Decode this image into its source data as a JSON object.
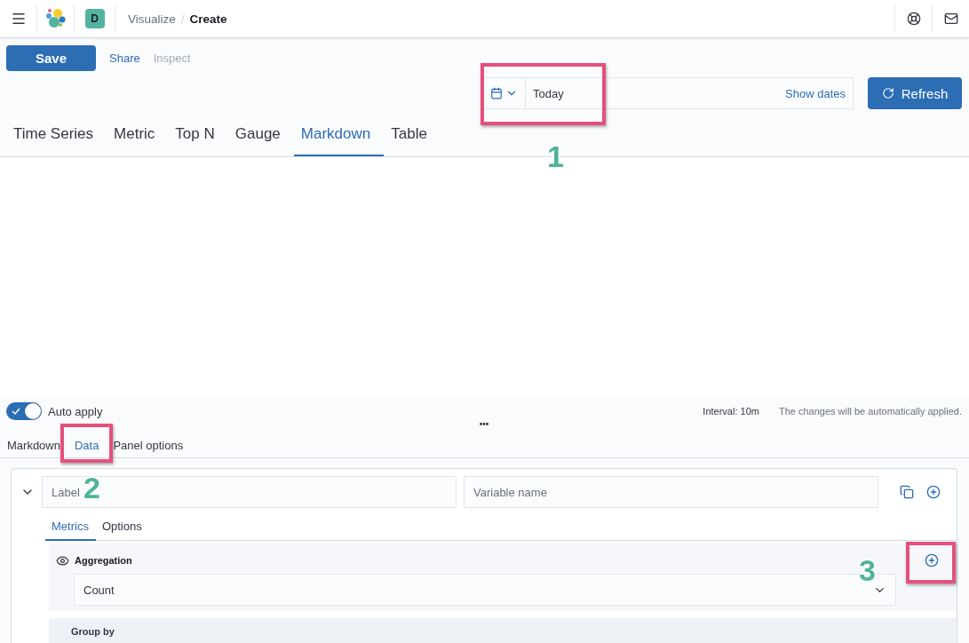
{
  "header": {
    "avatar": "D",
    "separator": "/",
    "breadcrumbs": [
      {
        "label": "Visualize",
        "current": false
      },
      {
        "label": "Create",
        "current": true
      }
    ]
  },
  "actions": [
    {
      "label": "Save",
      "kind": "primary",
      "disabled": false
    },
    {
      "label": "Share",
      "kind": "link",
      "disabled": false
    },
    {
      "label": "Inspect",
      "kind": "link",
      "disabled": true
    }
  ],
  "date_picker": {
    "value": "Today",
    "show_dates": "Show dates",
    "callout": "1"
  },
  "refresh": {
    "label": "Refresh"
  },
  "vis_tabs": [
    {
      "label": "Time Series",
      "selected": false
    },
    {
      "label": "Metric",
      "selected": false
    },
    {
      "label": "Top N",
      "selected": false
    },
    {
      "label": "Gauge",
      "selected": false
    },
    {
      "label": "Markdown",
      "selected": true
    },
    {
      "label": "Table",
      "selected": false
    }
  ],
  "auto_apply": {
    "label": "Auto apply",
    "on": true
  },
  "interval": "Interval: 10m",
  "apply_note": "The changes will be automatically applied.",
  "drag_handle": "•••",
  "editor_tabs": [
    {
      "label": "Markdown",
      "selected": false
    },
    {
      "label": "Data",
      "selected": true,
      "callout": "2"
    },
    {
      "label": "Panel options",
      "selected": false
    }
  ],
  "series": {
    "expanded": true,
    "label_placeholder": "Label",
    "variable_placeholder": "Variable name",
    "tabs": [
      {
        "label": "Metrics",
        "selected": true
      },
      {
        "label": "Options",
        "selected": false
      }
    ],
    "aggregation": {
      "title": "Aggregation",
      "value": "Count",
      "visible": true,
      "add_callout": "3"
    },
    "group_by": "Group by"
  }
}
